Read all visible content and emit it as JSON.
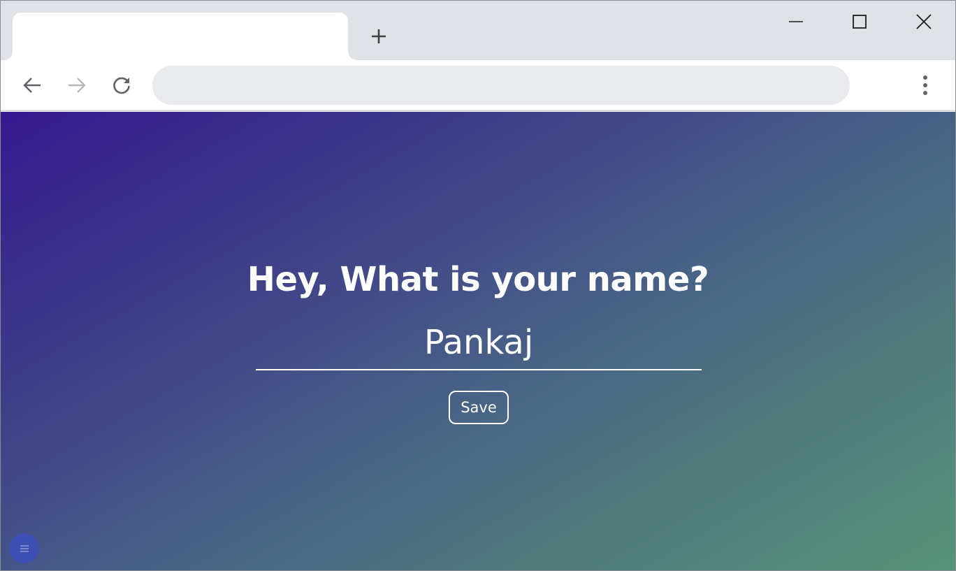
{
  "browser": {
    "tab": {
      "title": ""
    },
    "new_tab_label": "+",
    "omnibox": {
      "value": "",
      "placeholder": ""
    },
    "icons": {
      "back": "back-arrow-icon",
      "forward": "forward-arrow-icon",
      "reload": "reload-icon",
      "menu": "more-vert-icon",
      "minimize": "minimize-icon",
      "maximize": "maximize-icon",
      "close": "close-icon"
    },
    "colors": {
      "tabstrip": "#dee1e6",
      "omnibox": "#e8eaed"
    }
  },
  "page": {
    "greeting": "Hey, What is your name?",
    "name_input": {
      "value": "Pankaj"
    },
    "save_label": "Save",
    "fab_icon": "hamburger-menu-icon",
    "colors": {
      "gradient_start": "#35198f",
      "gradient_end": "#58937a",
      "text": "#ffffff",
      "fab": "#3d4fb8"
    }
  }
}
